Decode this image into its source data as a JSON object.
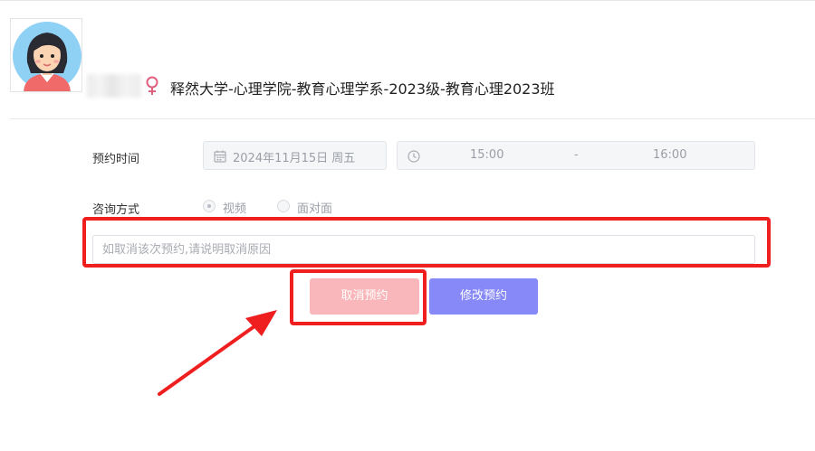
{
  "profile": {
    "gender_symbol": "♀",
    "class_info": "释然大学-心理学院-教育心理学系-2023级-教育心理2023班"
  },
  "form": {
    "time_label": "预约时间",
    "date_value": "2024年11月15日 周五",
    "time_start": "15:00",
    "time_separator": "-",
    "time_end": "16:00",
    "method_label": "咨询方式",
    "method_options": [
      {
        "label": "视频",
        "selected": true
      },
      {
        "label": "面对面",
        "selected": false
      }
    ],
    "reason_placeholder": "如取消该次预约,请说明取消原因",
    "reason_value": ""
  },
  "buttons": {
    "cancel_label": "取消预约",
    "modify_label": "修改预约"
  },
  "icons": {
    "date": "calendar-icon",
    "time": "clock-icon",
    "gender": "female-icon"
  },
  "colors": {
    "highlight": "#f01f1f",
    "cancel_button": "#f9b7bb",
    "modify_button": "#8689f7",
    "gender_symbol": "#e0607e"
  }
}
